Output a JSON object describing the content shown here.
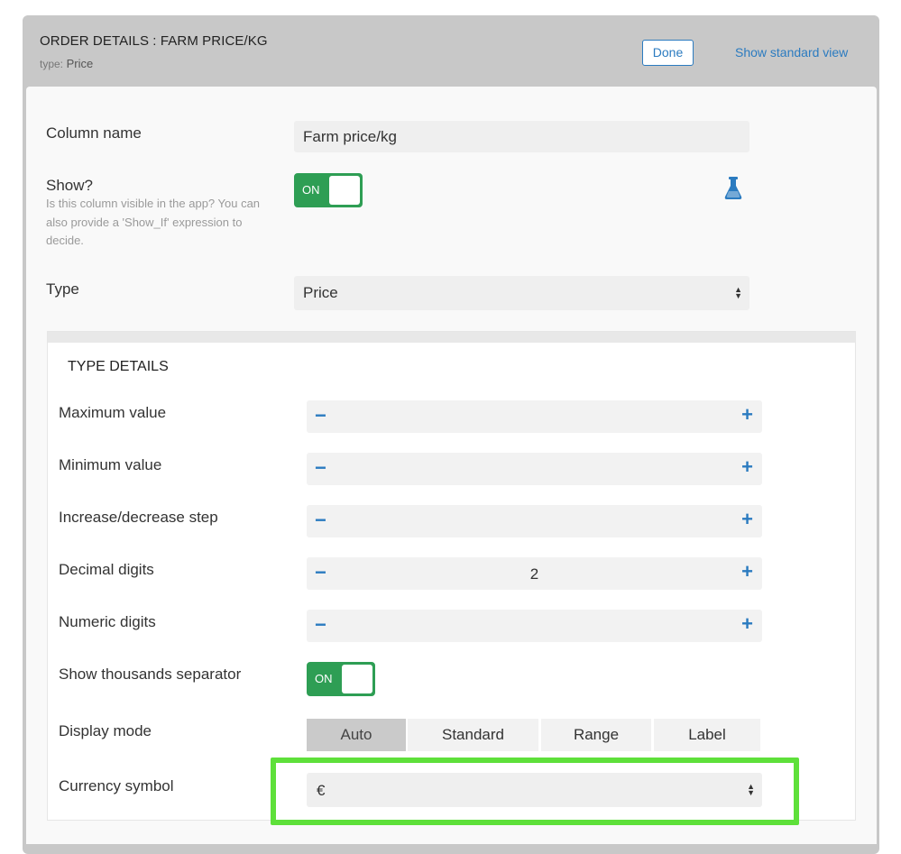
{
  "header": {
    "title": "ORDER DETAILS : FARM PRICE/KG",
    "type_label": "type:",
    "type_value": "Price",
    "done_label": "Done",
    "standard_view_label": "Show standard view"
  },
  "fields": {
    "column_name": {
      "label": "Column name",
      "value": "Farm price/kg"
    },
    "show": {
      "label": "Show?",
      "help": "Is this column visible in the app? You can also provide a 'Show_If' expression to decide.",
      "toggle_label": "ON"
    },
    "type": {
      "label": "Type",
      "value": "Price"
    }
  },
  "type_details": {
    "title": "TYPE DETAILS",
    "max_value": {
      "label": "Maximum value",
      "value": ""
    },
    "min_value": {
      "label": "Minimum value",
      "value": ""
    },
    "step": {
      "label": "Increase/decrease step",
      "value": ""
    },
    "decimal_digits": {
      "label": "Decimal digits",
      "value": "2"
    },
    "numeric_digits": {
      "label": "Numeric digits",
      "value": ""
    },
    "thousands_separator": {
      "label": "Show thousands separator",
      "toggle_label": "ON"
    },
    "display_mode": {
      "label": "Display mode",
      "options": [
        "Auto",
        "Standard",
        "Range",
        "Label"
      ],
      "selected": "Auto"
    },
    "currency_symbol": {
      "label": "Currency symbol",
      "value": "€"
    }
  },
  "icons": {
    "stepper_minus": "minus-icon",
    "stepper_plus": "plus-icon",
    "flask": "flask-icon",
    "select_arrows": "select-arrows-icon"
  },
  "colors": {
    "accent": "#2b7bc0",
    "toggle_on": "#2e9e54",
    "highlight": "#5ee03a",
    "header_bg": "#c8c8c8"
  }
}
